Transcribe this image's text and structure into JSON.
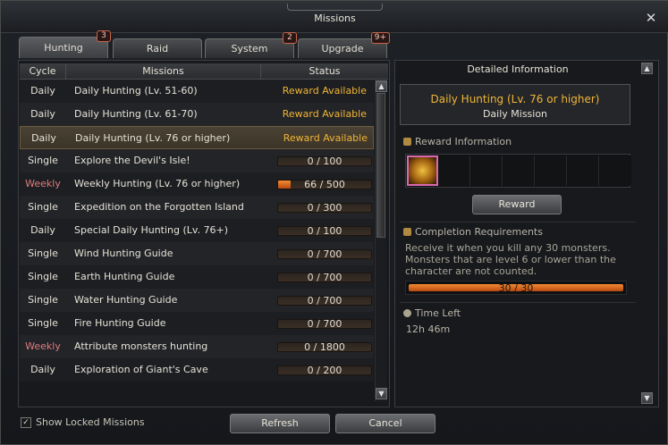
{
  "window": {
    "title": "Missions",
    "close_icon": "close-icon"
  },
  "tabs": [
    {
      "label": "Hunting",
      "badge": "3",
      "active": true
    },
    {
      "label": "Raid",
      "badge": "",
      "active": false
    },
    {
      "label": "System",
      "badge": "2",
      "active": false
    },
    {
      "label": "Upgrade",
      "badge": "9+",
      "active": false
    }
  ],
  "table": {
    "headers": {
      "cycle": "Cycle",
      "missions": "Missions",
      "status": "Status"
    },
    "rows": [
      {
        "cycle": "Daily",
        "mission": "Daily Hunting (Lv. 51-60)",
        "status": "Reward Available",
        "type": "reward"
      },
      {
        "cycle": "Daily",
        "mission": "Daily Hunting (Lv. 61-70)",
        "status": "Reward Available",
        "type": "reward"
      },
      {
        "cycle": "Daily",
        "mission": "Daily Hunting (Lv. 76 or higher)",
        "status": "Reward Available",
        "type": "reward",
        "selected": true
      },
      {
        "cycle": "Single",
        "mission": "Explore the Devil's Isle!",
        "status": "0 / 100",
        "type": "progress",
        "progress": 0
      },
      {
        "cycle": "Weekly",
        "mission": "Weekly Hunting (Lv. 76 or higher)",
        "status": "66 / 500",
        "type": "progress",
        "progress": 0.132
      },
      {
        "cycle": "Single",
        "mission": "Expedition on the Forgotten Island",
        "status": "0 / 300",
        "type": "progress",
        "progress": 0
      },
      {
        "cycle": "Daily",
        "mission": "Special Daily Hunting (Lv. 76+)",
        "status": "0 / 100",
        "type": "progress",
        "progress": 0
      },
      {
        "cycle": "Single",
        "mission": "Wind Hunting Guide",
        "status": "0 / 700",
        "type": "progress",
        "progress": 0
      },
      {
        "cycle": "Single",
        "mission": "Earth Hunting Guide",
        "status": "0 / 700",
        "type": "progress",
        "progress": 0
      },
      {
        "cycle": "Single",
        "mission": "Water Hunting Guide",
        "status": "0 / 700",
        "type": "progress",
        "progress": 0
      },
      {
        "cycle": "Single",
        "mission": "Fire Hunting Guide",
        "status": "0 / 700",
        "type": "progress",
        "progress": 0
      },
      {
        "cycle": "Weekly",
        "mission": "Attribute monsters hunting",
        "status": "0 / 1800",
        "type": "progress",
        "progress": 0
      },
      {
        "cycle": "Daily",
        "mission": "Exploration of Giant's Cave",
        "status": "0 / 200",
        "type": "progress",
        "progress": 0
      }
    ]
  },
  "detail": {
    "header": "Detailed Information",
    "mission_title": "Daily Hunting (Lv. 76 or higher)",
    "mission_subtitle": "Daily Mission",
    "reward_label": "Reward Information",
    "reward_button": "Reward",
    "completion_label": "Completion Requirements",
    "completion_text": "Receive it when you kill any 30 monsters. Monsters that are level 6 or lower than the character are not counted.",
    "completion_progress": "30 / 30",
    "completion_fraction": 1.0,
    "time_label": "Time Left",
    "time_value": "12h 46m"
  },
  "footer": {
    "show_locked_label": "Show Locked Missions",
    "show_locked_checked": true,
    "refresh_label": "Refresh",
    "cancel_label": "Cancel"
  },
  "colors": {
    "reward_text": "#f0b536",
    "weekly": "#e07c7c",
    "progress_fill": "#f58a30"
  }
}
